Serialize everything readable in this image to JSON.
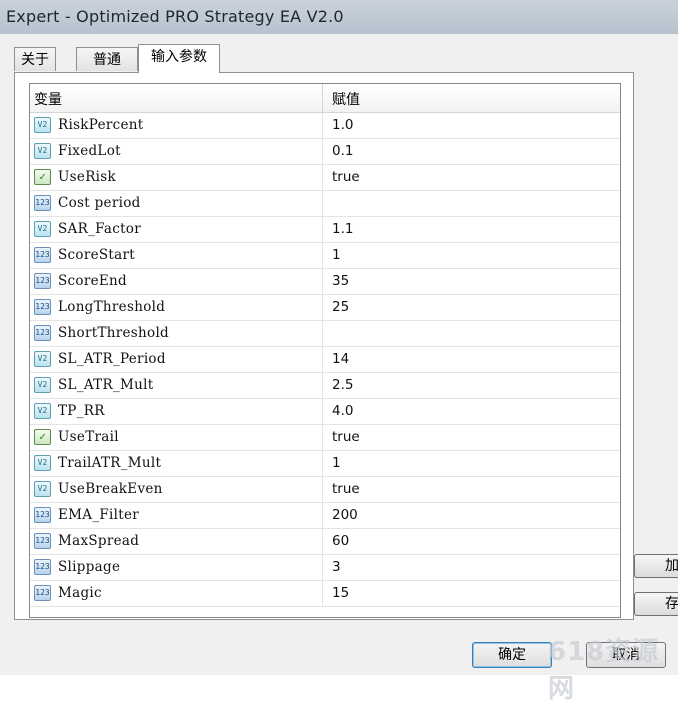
{
  "window": {
    "title": "Expert - Optimized PRO Strategy EA V2.0"
  },
  "tabs": [
    {
      "label": "关于",
      "active": false
    },
    {
      "label": "普通",
      "active": false
    },
    {
      "label": "输入参数",
      "active": true
    }
  ],
  "grid": {
    "headers": {
      "variable": "变量",
      "value": "赋值"
    },
    "rows": [
      {
        "icon": "double-icon",
        "glyph": "V2",
        "name": "RiskPercent",
        "value": "1.0"
      },
      {
        "icon": "double-icon",
        "glyph": "V2",
        "name": "FixedLot",
        "value": "0.1"
      },
      {
        "icon": "bool-icon",
        "glyph": "✓",
        "name": "UseRisk",
        "value": "true"
      },
      {
        "icon": "int-icon",
        "glyph": "123",
        "name": "Cost period",
        "value": ""
      },
      {
        "icon": "double-icon",
        "glyph": "V2",
        "name": "SAR_Factor",
        "value": "1.1"
      },
      {
        "icon": "int-icon",
        "glyph": "123",
        "name": "ScoreStart",
        "value": "1"
      },
      {
        "icon": "int-icon",
        "glyph": "123",
        "name": "ScoreEnd",
        "value": "35"
      },
      {
        "icon": "int-icon",
        "glyph": "123",
        "name": "LongThreshold",
        "value": "25"
      },
      {
        "icon": "int-icon",
        "glyph": "123",
        "name": "ShortThreshold",
        "value": ""
      },
      {
        "icon": "double-icon",
        "glyph": "V2",
        "name": "SL_ATR_Period",
        "value": "14"
      },
      {
        "icon": "double-icon",
        "glyph": "V2",
        "name": "SL_ATR_Mult",
        "value": "2.5"
      },
      {
        "icon": "double-icon",
        "glyph": "V2",
        "name": "TP_RR",
        "value": "4.0"
      },
      {
        "icon": "bool-icon",
        "glyph": "✓",
        "name": "UseTrail",
        "value": "true"
      },
      {
        "icon": "double-icon",
        "glyph": "V2",
        "name": "TrailATR_Mult",
        "value": "1"
      },
      {
        "icon": "double-icon",
        "glyph": "V2",
        "name": "UseBreakEven",
        "value": "true"
      },
      {
        "icon": "int-icon",
        "glyph": "123",
        "name": "EMA_Filter",
        "value": "200"
      },
      {
        "icon": "int-icon",
        "glyph": "123",
        "name": "MaxSpread",
        "value": "60"
      },
      {
        "icon": "int-icon",
        "glyph": "123",
        "name": "Slippage",
        "value": "3"
      },
      {
        "icon": "int-icon",
        "glyph": "123",
        "name": "Magic",
        "value": "15"
      }
    ]
  },
  "side_buttons": [
    {
      "label": "加"
    },
    {
      "label": "存"
    }
  ],
  "footer": {
    "ok_label": "确定",
    "cancel_label": "取消"
  },
  "watermark": {
    "text": "618资源网"
  }
}
